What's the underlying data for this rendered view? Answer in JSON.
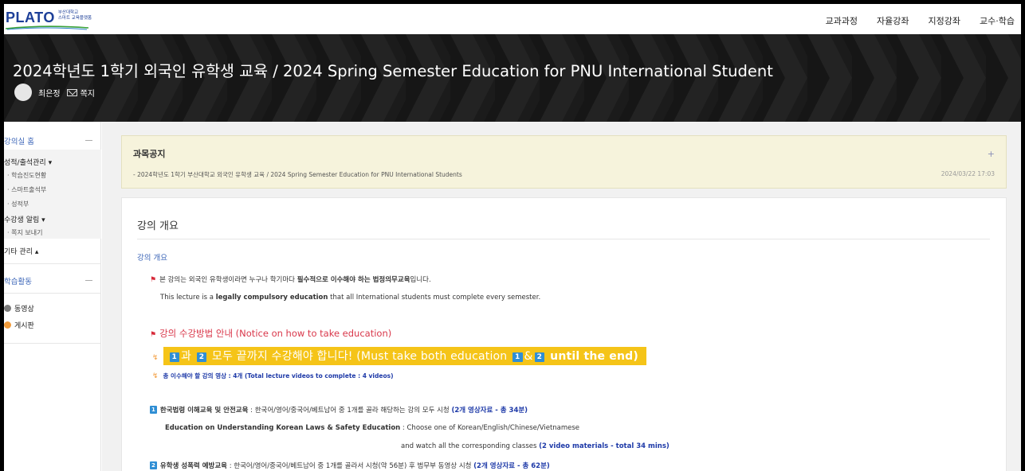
{
  "logo": {
    "text": "PLATO",
    "sub_line1": "부산대학교",
    "sub_line2": "스마트 교육플랫폼"
  },
  "topnav": [
    "교과과정",
    "자율강좌",
    "지정강좌",
    "교수·학습"
  ],
  "banner": {
    "title": "2024학년도 1학기 외국인 유학생 교육 / 2024 Spring Semester Education for PNU International Student",
    "instructor": "최은정",
    "message_label": "쪽지"
  },
  "sidebar": {
    "home": "강의실 홈",
    "grades": "성적/출석관리 ▾",
    "grades_items": [
      "학습진도현황",
      "스마트출석부",
      "성적부"
    ],
    "alerts": "수강생 알림 ▾",
    "alerts_items": [
      "쪽지 보내기"
    ],
    "other": "기타 관리 ▴",
    "activities": "학습활동",
    "activity_items": [
      {
        "label": "동영상",
        "color": "#7b7b7b"
      },
      {
        "label": "게시판",
        "color": "#f29b3a"
      }
    ]
  },
  "notice": {
    "title": "과목공지",
    "plus": "+",
    "item": "- 2024학년도 1학기 부산대학교 외국인 유학생 교육 / 2024 Spring Semester Education for PNU International Students",
    "date": "2024/03/22 17:03"
  },
  "content": {
    "title": "강의 개요",
    "subtitle": "강의 개요",
    "l1_pre": "본 강의는 외국인 유학생이라면 누구나 학기마다 ",
    "l1_bold": "필수적으로 이수해야 하는 법정의무교육",
    "l1_post": "입니다.",
    "l2_pre": "This lecture is a ",
    "l2_bold": "legally compulsory education",
    "l2_post": " that all International students must complete every semester.",
    "how_to": "강의 수강방법 안내  (Notice on how to take education)",
    "hl_num1": "1",
    "hl_t1": "과",
    "hl_num2": "2",
    "hl_t2": " 모두 끝까지 수강해야 합니다! (Must take both education ",
    "hl_num3": "1",
    "hl_amp": "&",
    "hl_num4": "2",
    "hl_t3": " until the end)",
    "total": "총 이수해야 할 강의 영상 : 4개 (Total lecture videos to complete : 4 videos)",
    "s1_num": "1",
    "s1_bold": "한국법령 이해교육 및 안전교육",
    "s1_text": " : 한국어/영어/중국어/베트남어 중 1개를 골라 해당하는 강의 모두 시청 ",
    "s1_blue": "(2개 영상자료 - 총 34분)",
    "s1_en_bold": "Education on Understanding Korean Laws & Safety Education",
    "s1_en_text": " : Choose one of Korean/English/Chinese/Vietnamese",
    "s1_en2_text": "and watch all the corresponding classes ",
    "s1_en2_blue": "(2 video materials - total 34 mins)",
    "s2_num": "2",
    "s2_bold": "유학생 성폭력 예방교육",
    "s2_text": " : 한국어/영어/중국어/베트남어 중 1개를 골라서 시청(약 56분) 후  범무부 동영상 시청 ",
    "s2_blue": "(2개 영상자료 - 총 62분)"
  }
}
